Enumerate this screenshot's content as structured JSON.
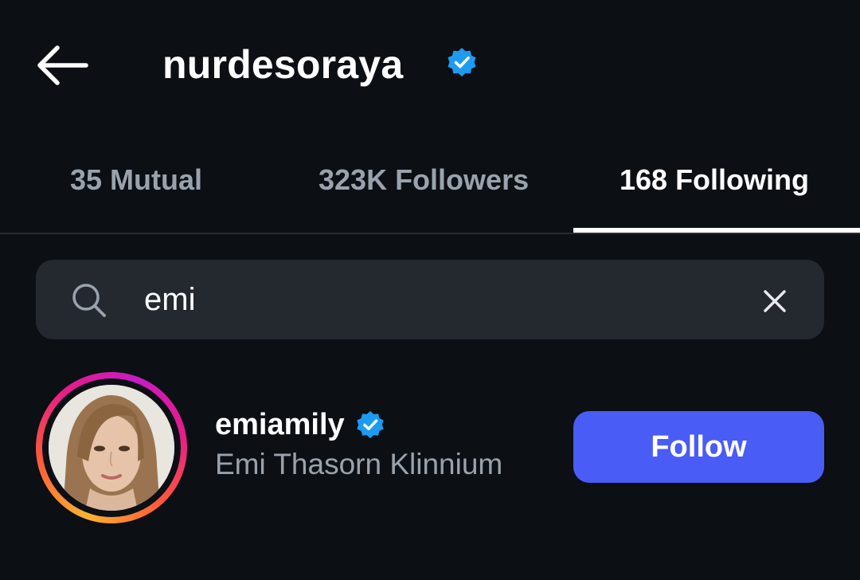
{
  "header": {
    "title": "nurdesoraya",
    "back_icon": "arrow-left-icon",
    "verified_icon": "verified-badge-icon"
  },
  "tabs": [
    {
      "label": "35 Mutual",
      "active": false
    },
    {
      "label": "323K Followers",
      "active": false
    },
    {
      "label": "168 Following",
      "active": true
    }
  ],
  "search": {
    "value": "emi",
    "icon": "search-icon",
    "clear_icon": "close-icon"
  },
  "results": [
    {
      "username": "emiamily",
      "full_name": "Emi Thasorn Klinnium",
      "verified": true,
      "follow_label": "Follow"
    }
  ],
  "colors": {
    "background": "#0c0f14",
    "search_bg": "#24282f",
    "follow_button": "#4a5cf6",
    "verified_badge": "#1d9bf0",
    "muted_text": "#9aa3ad"
  }
}
